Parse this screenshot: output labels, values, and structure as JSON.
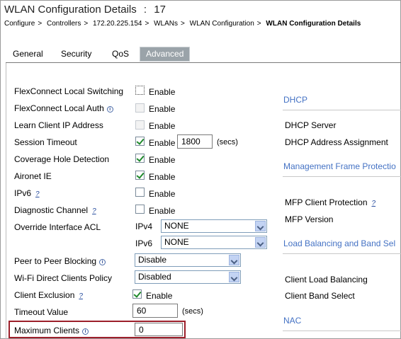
{
  "header": {
    "title": "WLAN Configuration Details",
    "title_sep": ":",
    "wlan_id": "17",
    "breadcrumb": [
      "Configure",
      "Controllers",
      "172.20.225.154",
      "WLANs",
      "WLAN Configuration",
      "WLAN Configuration Details"
    ],
    "crumb_sep": ">"
  },
  "tabs": [
    "General",
    "Security",
    "QoS",
    "Advanced"
  ],
  "active_tab": "Advanced",
  "left": {
    "flexconnect_local_switching": {
      "label": "FlexConnect Local Switching",
      "option": "Enable"
    },
    "flexconnect_local_auth": {
      "label": "FlexConnect Local Auth",
      "option": "Enable"
    },
    "learn_client_ip": {
      "label": "Learn Client IP Address",
      "option": "Enable"
    },
    "session_timeout": {
      "label": "Session Timeout",
      "option": "Enable",
      "value": "1800",
      "unit": "(secs)"
    },
    "coverage_hole": {
      "label": "Coverage Hole Detection",
      "option": "Enable"
    },
    "aironet_ie": {
      "label": "Aironet IE",
      "option": "Enable"
    },
    "ipv6": {
      "label": "IPv6",
      "option": "Enable"
    },
    "diagnostic_channel": {
      "label": "Diagnostic Channel",
      "option": "Enable"
    },
    "override_acl": {
      "label": "Override Interface ACL",
      "ipv4_label": "IPv4",
      "ipv4_value": "NONE",
      "ipv6_label": "IPv6",
      "ipv6_value": "NONE"
    },
    "p2p_blocking": {
      "label": "Peer to Peer Blocking",
      "value": "Disable"
    },
    "wifi_direct": {
      "label": "Wi-Fi Direct Clients Policy",
      "value": "Disabled"
    },
    "client_exclusion": {
      "label": "Client Exclusion",
      "option": "Enable"
    },
    "timeout_value": {
      "label": "Timeout Value",
      "value": "60",
      "unit": "(secs)"
    },
    "max_clients": {
      "label": "Maximum Clients",
      "value": "0"
    }
  },
  "right": {
    "dhcp": {
      "title": "DHCP",
      "server": "DHCP Server",
      "assignment": "DHCP Address Assignment"
    },
    "mfp": {
      "title": "Management Frame Protectio",
      "client_protection": "MFP Client Protection",
      "version": "MFP Version"
    },
    "lb": {
      "title": "Load Balancing and Band Sel",
      "client_lb": "Client Load Balancing",
      "band_select": "Client Band Select"
    },
    "nac": {
      "title": "NAC"
    }
  },
  "icons": {
    "info": "i",
    "help": "?"
  },
  "colors": {
    "section_title": "#4472c4",
    "highlight_border": "#9c1f2a",
    "check": "#1f8a2c",
    "active_tab": "#9aa3a9"
  }
}
